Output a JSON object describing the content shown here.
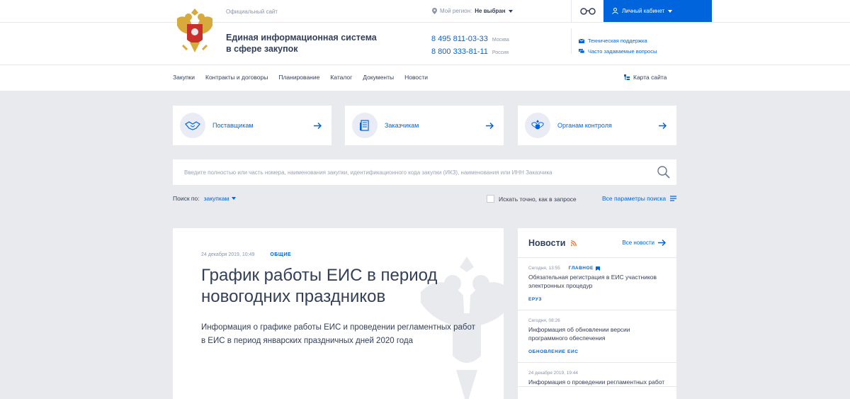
{
  "topbar": {
    "official_label": "Официальный сайт",
    "region_label": "Мой регион:",
    "region_value": "Не выбран",
    "cabinet_label": "Личный кабинет"
  },
  "header": {
    "title_line1": "Единая информационная система",
    "title_line2": "в сфере закупок",
    "phones": [
      {
        "number": "8 495 811-03-33",
        "city": "Москва"
      },
      {
        "number": "8 800 333-81-11",
        "city": "Россия"
      }
    ],
    "support_label": "Техническая поддержка",
    "faq_label": "Часто задаваемые вопросы"
  },
  "nav": {
    "items": [
      "Закупки",
      "Контракты и договоры",
      "Планирование",
      "Каталог",
      "Документы",
      "Новости"
    ],
    "sitemap_label": "Карта сайта"
  },
  "cards": [
    {
      "label": "Поставщикам",
      "icon": "handshake-icon"
    },
    {
      "label": "Заказчикам",
      "icon": "document-building-icon"
    },
    {
      "label": "Органам контроля",
      "icon": "emblem-icon"
    }
  ],
  "search": {
    "placeholder": "Введите полностью или часть номера, наименования закупки, идентификационного кода закупки (ИКЗ), наименования или ИНН Заказчика",
    "search_by_label": "Поиск по:",
    "search_by_value": "закупкам",
    "exact_label": "Искать точно, как в запросе",
    "all_params_label": "Все параметры поиска"
  },
  "feature": {
    "date": "24 декабря 2019, 10:49",
    "tag": "ОБЩИЕ",
    "title": "График работы ЕИС в период новогодних праздников",
    "text": "Информация о графике работы ЕИС и проведении регламентных работ в ЕИС в период январских праздничных дней 2020 года"
  },
  "news": {
    "title": "Новости",
    "all_label": "Все новости",
    "items": [
      {
        "date": "Сегодня, 13:55",
        "badge": "ГЛАВНОЕ",
        "text": "Обязательная регистрация в ЕИС участников электронных процедур",
        "tag": "ЕРУЗ"
      },
      {
        "date": "Сегодня, 08:26",
        "badge": "",
        "text": "Информация об обновлении версии программного обеспечения",
        "tag": "ОБНОВЛЕНИЕ ЕИС"
      },
      {
        "date": "24 декабря 2019, 19:44",
        "badge": "",
        "text": "Информация о проведении регламентных работ",
        "tag": ""
      }
    ]
  },
  "colors": {
    "accent": "#0065dd",
    "background": "#e9eaed",
    "text": "#334059",
    "rss": "#f26522"
  }
}
